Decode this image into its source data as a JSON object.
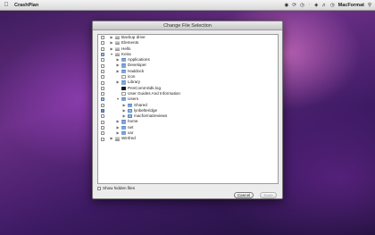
{
  "menubar": {
    "app_name": "CrashPlan",
    "user_name": "MacFormat",
    "status_icons": [
      "crashplan-icon",
      "sync-icon",
      "time-machine-icon",
      "bluetooth-icon",
      "wifi-icon",
      "volume-icon",
      "clock-icon"
    ]
  },
  "dialog": {
    "title": "Change File Selection",
    "show_hidden_label": "Show hidden files",
    "show_hidden_checked": false,
    "cancel_label": "Cancel",
    "save_label": "Save"
  },
  "tree": [
    {
      "label": "Backup drive",
      "depth": 0,
      "icon": "drive",
      "expanded": false,
      "state": "unchecked"
    },
    {
      "label": "Elements",
      "depth": 0,
      "icon": "drive",
      "expanded": false,
      "state": "unchecked"
    },
    {
      "label": "Hello",
      "depth": 0,
      "icon": "drive",
      "expanded": false,
      "state": "unchecked"
    },
    {
      "label": "Keira",
      "depth": 0,
      "icon": "drive",
      "expanded": true,
      "state": "mixed"
    },
    {
      "label": "Applications",
      "depth": 1,
      "icon": "folder",
      "expanded": false,
      "state": "unchecked"
    },
    {
      "label": "Developer",
      "depth": 1,
      "icon": "folder",
      "expanded": false,
      "state": "unchecked"
    },
    {
      "label": "Haddock",
      "depth": 1,
      "icon": "folder",
      "expanded": false,
      "state": "unchecked"
    },
    {
      "label": "icon",
      "depth": 1,
      "icon": "file",
      "expanded": null,
      "state": "unchecked"
    },
    {
      "label": "Library",
      "depth": 1,
      "icon": "folder",
      "expanded": false,
      "state": "unchecked"
    },
    {
      "label": "PenCommSdk.log",
      "depth": 1,
      "icon": "term",
      "expanded": null,
      "state": "unchecked"
    },
    {
      "label": "User Guides And Information",
      "depth": 1,
      "icon": "file",
      "expanded": null,
      "state": "unchecked"
    },
    {
      "label": "Users",
      "depth": 1,
      "icon": "folder",
      "expanded": true,
      "state": "mixed"
    },
    {
      "label": "Shared",
      "depth": 2,
      "icon": "folder",
      "expanded": false,
      "state": "unchecked"
    },
    {
      "label": "lynbelteridge",
      "depth": 2,
      "icon": "home",
      "expanded": false,
      "state": "checked"
    },
    {
      "label": "macformatreviews",
      "depth": 2,
      "icon": "home",
      "expanded": false,
      "state": "unchecked"
    },
    {
      "label": "home",
      "depth": 1,
      "icon": "folder",
      "expanded": false,
      "state": "unchecked"
    },
    {
      "label": "net",
      "depth": 1,
      "icon": "folder",
      "expanded": false,
      "state": "unchecked"
    },
    {
      "label": "var",
      "depth": 1,
      "icon": "folder",
      "expanded": false,
      "state": "unchecked"
    },
    {
      "label": "Winfred",
      "depth": 0,
      "icon": "drive",
      "expanded": false,
      "state": "unchecked"
    }
  ]
}
